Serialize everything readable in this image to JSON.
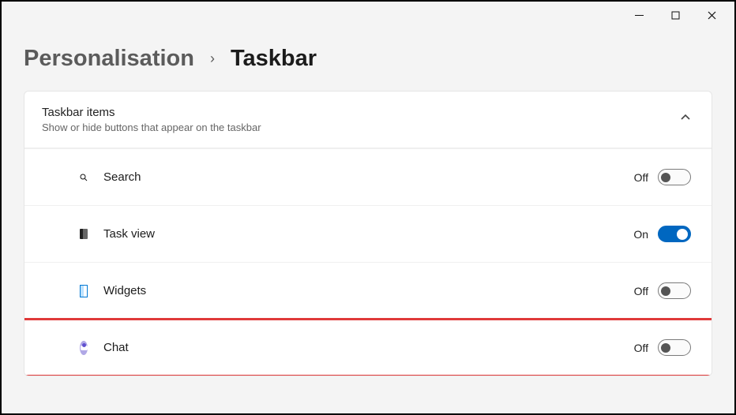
{
  "breadcrumb": {
    "parent": "Personalisation",
    "current": "Taskbar"
  },
  "section": {
    "title": "Taskbar items",
    "subtitle": "Show or hide buttons that appear on the taskbar"
  },
  "state_labels": {
    "on": "On",
    "off": "Off"
  },
  "items": [
    {
      "id": "search",
      "label": "Search",
      "state": "off"
    },
    {
      "id": "taskview",
      "label": "Task view",
      "state": "on"
    },
    {
      "id": "widgets",
      "label": "Widgets",
      "state": "off"
    },
    {
      "id": "chat",
      "label": "Chat",
      "state": "off"
    }
  ]
}
